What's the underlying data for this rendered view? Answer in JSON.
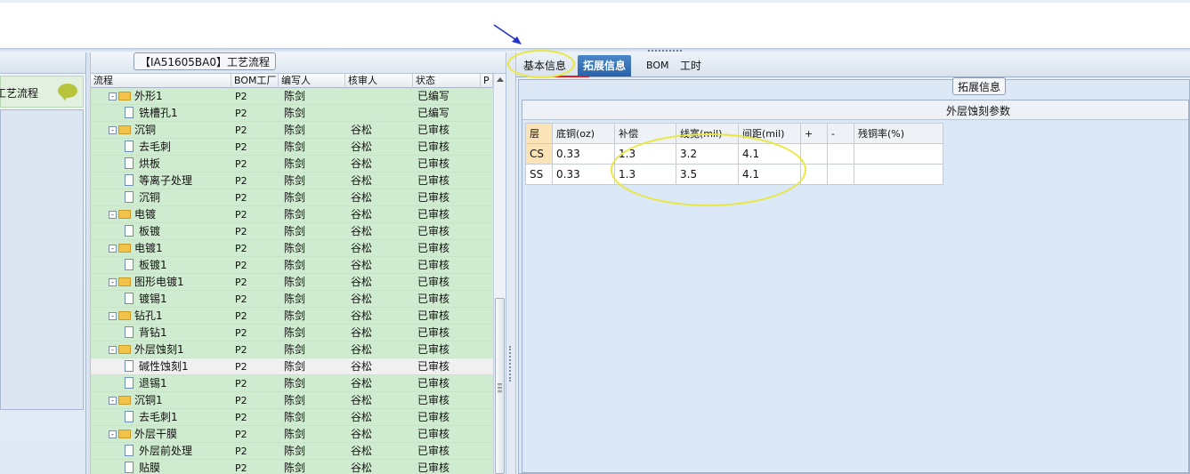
{
  "left_panel": {
    "flow_label": "工艺流程"
  },
  "mid": {
    "title": "【IA51605BA0】工艺流程",
    "columns": [
      "流程",
      "BOM工厂",
      "编写人",
      "核审人",
      "状态",
      "P"
    ],
    "rows": [
      {
        "type": "folder",
        "name": "外形1",
        "bom": "P2",
        "writer": "陈剑",
        "reviewer": "",
        "state": "已编写"
      },
      {
        "type": "doc",
        "name": "铣槽孔1",
        "bom": "P2",
        "writer": "陈剑",
        "reviewer": "",
        "state": "已编写"
      },
      {
        "type": "folder",
        "name": "沉铜",
        "bom": "P2",
        "writer": "陈剑",
        "reviewer": "谷松",
        "state": "已审核"
      },
      {
        "type": "doc",
        "name": "去毛刺",
        "bom": "P2",
        "writer": "陈剑",
        "reviewer": "谷松",
        "state": "已审核"
      },
      {
        "type": "doc",
        "name": "烘板",
        "bom": "P2",
        "writer": "陈剑",
        "reviewer": "谷松",
        "state": "已审核"
      },
      {
        "type": "doc",
        "name": "等离子处理",
        "bom": "P2",
        "writer": "陈剑",
        "reviewer": "谷松",
        "state": "已审核"
      },
      {
        "type": "doc",
        "name": "沉铜",
        "bom": "P2",
        "writer": "陈剑",
        "reviewer": "谷松",
        "state": "已审核"
      },
      {
        "type": "folder",
        "name": "电镀",
        "bom": "P2",
        "writer": "陈剑",
        "reviewer": "谷松",
        "state": "已审核"
      },
      {
        "type": "doc",
        "name": "板镀",
        "bom": "P2",
        "writer": "陈剑",
        "reviewer": "谷松",
        "state": "已审核"
      },
      {
        "type": "folder",
        "name": "电镀1",
        "bom": "P2",
        "writer": "陈剑",
        "reviewer": "谷松",
        "state": "已审核"
      },
      {
        "type": "doc",
        "name": "板镀1",
        "bom": "P2",
        "writer": "陈剑",
        "reviewer": "谷松",
        "state": "已审核"
      },
      {
        "type": "folder",
        "name": "图形电镀1",
        "bom": "P2",
        "writer": "陈剑",
        "reviewer": "谷松",
        "state": "已审核"
      },
      {
        "type": "doc",
        "name": "镀锡1",
        "bom": "P2",
        "writer": "陈剑",
        "reviewer": "谷松",
        "state": "已审核"
      },
      {
        "type": "folder",
        "name": "钻孔1",
        "bom": "P2",
        "writer": "陈剑",
        "reviewer": "谷松",
        "state": "已审核"
      },
      {
        "type": "doc",
        "name": "背钻1",
        "bom": "P2",
        "writer": "陈剑",
        "reviewer": "谷松",
        "state": "已审核"
      },
      {
        "type": "folder",
        "name": "外层蚀刻1",
        "bom": "P2",
        "writer": "陈剑",
        "reviewer": "谷松",
        "state": "已审核"
      },
      {
        "type": "doc",
        "name": "碱性蚀刻1",
        "bom": "P2",
        "writer": "陈剑",
        "reviewer": "谷松",
        "state": "已审核",
        "selected": true
      },
      {
        "type": "doc",
        "name": "退锡1",
        "bom": "P2",
        "writer": "陈剑",
        "reviewer": "谷松",
        "state": "已审核"
      },
      {
        "type": "folder",
        "name": "沉铜1",
        "bom": "P2",
        "writer": "陈剑",
        "reviewer": "谷松",
        "state": "已审核"
      },
      {
        "type": "doc",
        "name": "去毛刺1",
        "bom": "P2",
        "writer": "陈剑",
        "reviewer": "谷松",
        "state": "已审核"
      },
      {
        "type": "folder",
        "name": "外层干膜",
        "bom": "P2",
        "writer": "陈剑",
        "reviewer": "谷松",
        "state": "已审核"
      },
      {
        "type": "doc",
        "name": "外层前处理",
        "bom": "P2",
        "writer": "陈剑",
        "reviewer": "谷松",
        "state": "已审核"
      },
      {
        "type": "doc",
        "name": "贴膜",
        "bom": "P2",
        "writer": "陈剑",
        "reviewer": "谷松",
        "state": "已审核"
      }
    ]
  },
  "right": {
    "tabs": [
      "基本信息",
      "拓展信息",
      "BOM",
      "工时"
    ],
    "active_tab": "拓展信息",
    "group_title": "拓展信息",
    "table_title": "外层蚀刻参数",
    "table_headers": [
      "层",
      "底铜(oz)",
      "补偿",
      "线宽(mil)",
      "间距(mil)",
      "+",
      "-",
      "残铜率(%)"
    ],
    "table_rows": [
      [
        "CS",
        "0.33",
        "1.3",
        "3.2",
        "4.1",
        "",
        "",
        ""
      ],
      [
        "SS",
        "0.33",
        "1.3",
        "3.5",
        "4.1",
        "",
        "",
        ""
      ]
    ]
  },
  "colors": {
    "tree_row_bg": "#d0ecd0",
    "active_tab_bg": "#2a62a8",
    "layer_cell_bg": "#fbe3b5",
    "annotation": "#e8e840",
    "arrow": "#2233cc"
  }
}
